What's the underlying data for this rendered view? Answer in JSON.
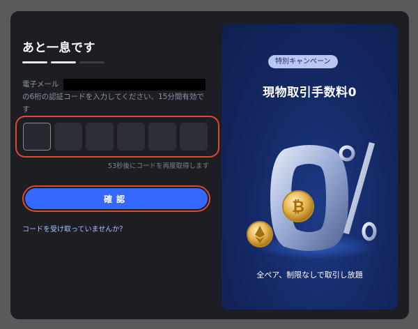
{
  "verify": {
    "title": "あと一息です",
    "progress_steps": [
      true,
      true,
      false
    ],
    "email_label": "電子メール",
    "description": "の6桁の認証コードを入力してください、15分間有効です",
    "code_digits": [
      "",
      "",
      "",
      "",
      "",
      ""
    ],
    "resend_text": "53秒後にコードを再度取得します",
    "confirm_label": "確認",
    "help_link": "コードを受け取っていませんか？"
  },
  "promo": {
    "badge": "特別キャンペーン",
    "title": "現物取引手数料0",
    "footer": "全ペア、制限なしで取引し放題"
  },
  "colors": {
    "modal_bg": "#1c1e24",
    "accent_blue": "#3568ff",
    "highlight_red": "#e0492f",
    "promo_bg": "#142a66"
  }
}
